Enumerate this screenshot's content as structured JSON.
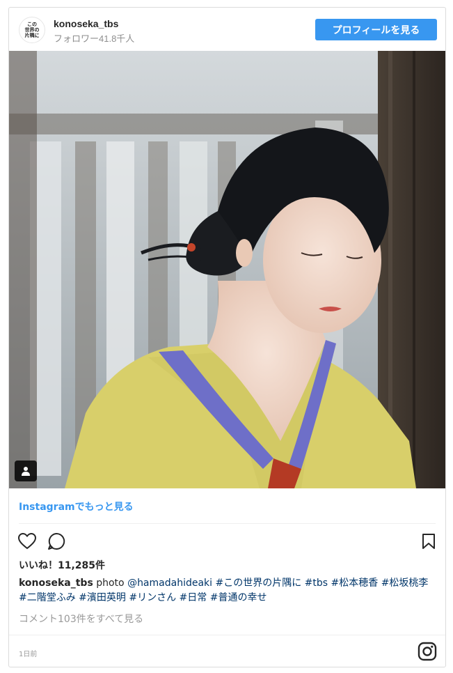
{
  "header": {
    "avatar_text": "この\n世界の\n片隅に",
    "username": "konoseka_tbs",
    "followers": "フォロワー41.8千人",
    "profile_button": "プロフィールを見る"
  },
  "photo": {
    "icon": "user-tag-icon",
    "kimono_color": "#d8cf6a",
    "collar_color": "#6e6fc8",
    "hair_color": "#14161a"
  },
  "view_more": "Instagramでもっと見る",
  "actions": {
    "like_icon": "heart-icon",
    "comment_icon": "comment-icon",
    "save_icon": "bookmark-icon"
  },
  "likes": "いいね！11,285件",
  "caption": {
    "username": "konoseka_tbs",
    "text_plain": " photo ",
    "tags_line": "@hamadahideaki #この世界の片隅に #tbs #松本穂香 #松坂桃李 #二階堂ふみ #濱田英明 #リンさん #日常 #普通の幸せ"
  },
  "comments_link": "コメント103件をすべて見る",
  "timestamp": "1日前",
  "brand_icon": "instagram-icon",
  "colors": {
    "accent": "#3897f0",
    "link": "#003569"
  }
}
